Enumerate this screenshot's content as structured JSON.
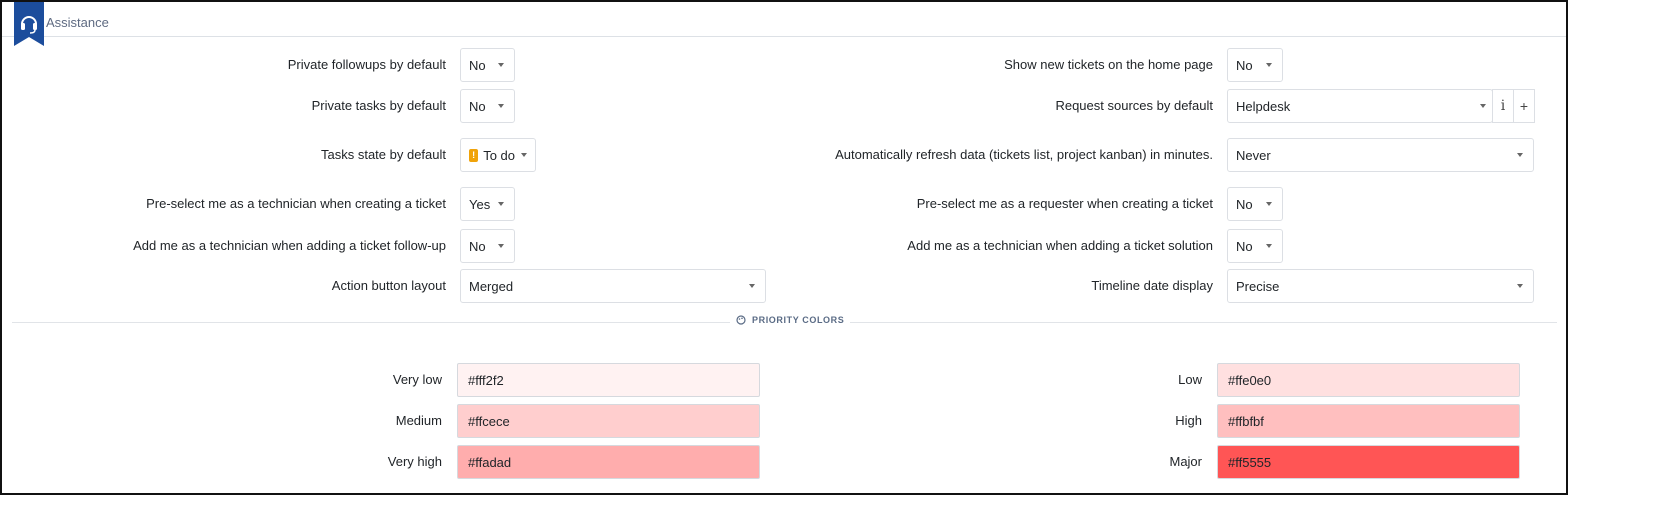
{
  "header": {
    "title": "Assistance"
  },
  "left_rows": [
    {
      "label": "Private followups by default",
      "value": "No"
    },
    {
      "label": "Private tasks by default",
      "value": "No"
    },
    {
      "label": "Tasks state by default",
      "value": "To do"
    },
    {
      "label": "Pre-select me as a technician when creating a ticket",
      "value": "Yes"
    },
    {
      "label": "Add me as a technician when adding a ticket follow-up",
      "value": "No"
    },
    {
      "label": "Action button layout",
      "value": "Merged"
    }
  ],
  "right_rows": [
    {
      "label": "Show new tickets on the home page",
      "value": "No"
    },
    {
      "label": "Request sources by default",
      "value": "Helpdesk",
      "info_btn": "i",
      "add_btn": "+"
    },
    {
      "label": "Automatically refresh data (tickets list, project kanban) in minutes.",
      "value": "Never"
    },
    {
      "label": "Pre-select me as a requester when creating a ticket",
      "value": "No"
    },
    {
      "label": "Add me as a technician when adding a ticket solution",
      "value": "No"
    },
    {
      "label": "Timeline date display",
      "value": "Precise"
    }
  ],
  "priority_section": {
    "title": "PRIORITY COLORS"
  },
  "priority_colors": [
    {
      "label": "Very low",
      "value": "#fff2f2"
    },
    {
      "label": "Low",
      "value": "#ffe0e0"
    },
    {
      "label": "Medium",
      "value": "#ffcece"
    },
    {
      "label": "High",
      "value": "#ffbfbf"
    },
    {
      "label": "Very high",
      "value": "#ffadad"
    },
    {
      "label": "Major",
      "value": "#ff5555"
    }
  ],
  "colors": {
    "brand": "#1c4d9c",
    "todo": "#f0a30a"
  }
}
